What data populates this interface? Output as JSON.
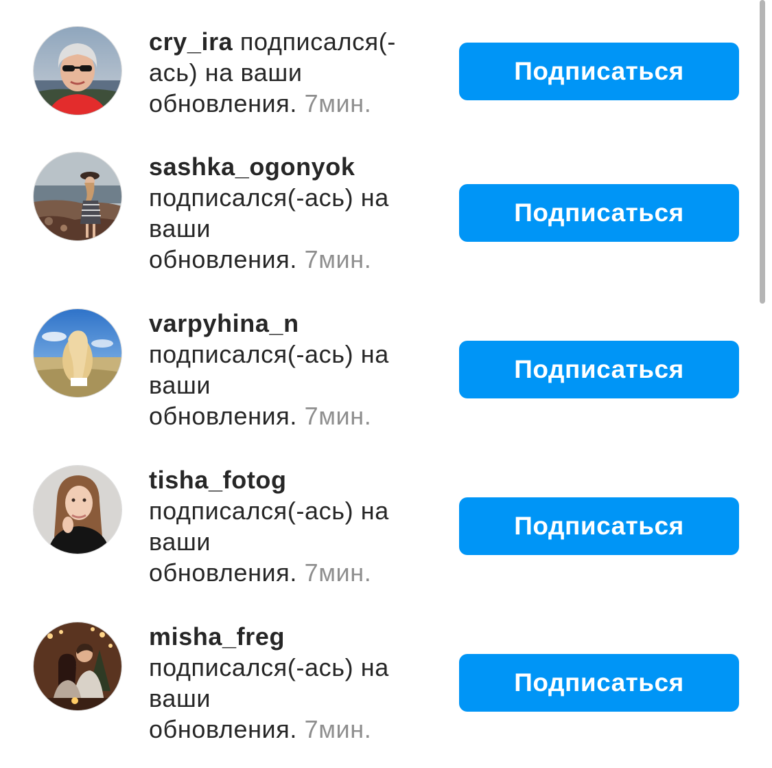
{
  "notifications": [
    {
      "username": "cry_ira",
      "action_first": " подписался(-ась) на ваши",
      "action_last": "обновления.",
      "time": "7мин.",
      "button_label": "Подписаться",
      "avatar_icon": "avatar-woman-sunglasses"
    },
    {
      "username": "sashka_ogonyok",
      "action_first": "подписался(-ась) на ваши",
      "action_last": "обновления.",
      "time": "7мин.",
      "button_label": "Подписаться",
      "avatar_icon": "avatar-girl-seashore"
    },
    {
      "username": "varpyhina_n",
      "action_first": "подписался(-ась) на ваши",
      "action_last": "обновления.",
      "time": "7мин.",
      "button_label": "Подписаться",
      "avatar_icon": "avatar-girl-wheat-field"
    },
    {
      "username": "tisha_fotog",
      "action_first": "подписался(-ась) на ваши",
      "action_last": "обновления.",
      "time": "7мин.",
      "button_label": "Подписаться",
      "avatar_icon": "avatar-girl-portrait"
    },
    {
      "username": "misha_freg",
      "action_first": "подписался(-ась) на ваши",
      "action_last": "обновления.",
      "time": "7мин.",
      "button_label": "Подписаться",
      "avatar_icon": "avatar-couple-evening"
    }
  ],
  "colors": {
    "button_bg": "#0095f6",
    "text": "#262626",
    "muted": "#8e8e8e"
  }
}
